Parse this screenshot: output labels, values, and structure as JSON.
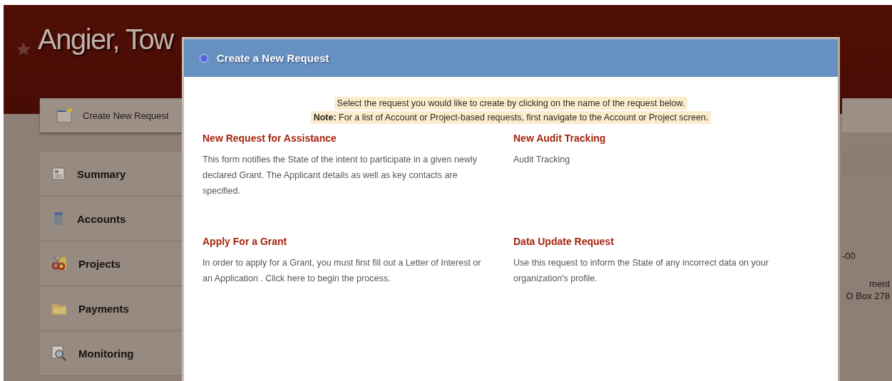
{
  "header": {
    "title": "Angier, Tow"
  },
  "toolbar": {
    "create_button": "Create New Request"
  },
  "sidebar": {
    "items": [
      {
        "label": "Summary",
        "kind": "summary"
      },
      {
        "label": "Accounts",
        "kind": "accounts"
      },
      {
        "label": "Projects",
        "kind": "projects"
      },
      {
        "label": "Payments",
        "kind": "payments"
      },
      {
        "label": "Monitoring",
        "kind": "monitoring"
      }
    ]
  },
  "background_fragments": [
    "-00",
    "ment",
    "O Box 278"
  ],
  "dialog": {
    "title": "Create a New Request",
    "instruction": "Select the request you would like to create by clicking on the name of the request below.",
    "note": "**Note:** For a list of Account or Project-based requests, first navigate to the Account or Project screen.",
    "requests": [
      {
        "name": "New Request for Assistance",
        "description": "This form notifies the State of the intent to participate in a given newly declared Grant. The Applicant details as well as key contacts are specified."
      },
      {
        "name": "New Audit Tracking",
        "description": "Audit Tracking"
      },
      {
        "name": "Apply For a Grant",
        "description": "In order to apply for a Grant, you must first fill out a Letter of Interest or an Application . Click here to begin the process."
      },
      {
        "name": "Data Update Request",
        "description": "Use this request to inform the State of any incorrect data on your organization's profile."
      }
    ]
  }
}
